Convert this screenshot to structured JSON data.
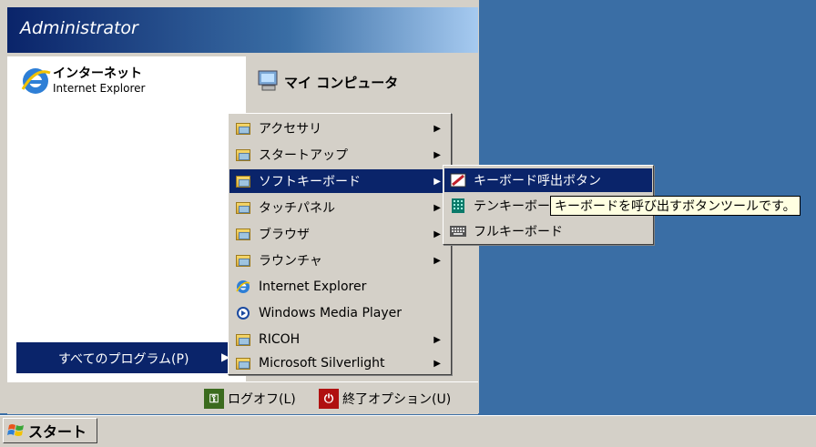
{
  "start_menu": {
    "user_name": "Administrator",
    "pinned_ie_title": "インターネット",
    "pinned_ie_subtitle": "Internet Explorer",
    "my_computer": "マイ コンピュータ",
    "all_programs": "すべてのプログラム(P)",
    "logoff": "ログオフ(L)",
    "shutdown": "終了オプション(U)"
  },
  "programs_menu": {
    "items": [
      {
        "label": "アクセサリ",
        "icon": "folder-icon",
        "has_submenu": true
      },
      {
        "label": "スタートアップ",
        "icon": "folder-icon",
        "has_submenu": true
      },
      {
        "label": "ソフトキーボード",
        "icon": "folder-icon",
        "has_submenu": true,
        "selected": true
      },
      {
        "label": "タッチパネル",
        "icon": "folder-icon",
        "has_submenu": true
      },
      {
        "label": "ブラウザ",
        "icon": "folder-icon",
        "has_submenu": true
      },
      {
        "label": "ラウンチャ",
        "icon": "folder-icon",
        "has_submenu": true
      },
      {
        "label": "Internet Explorer",
        "icon": "ie-icon",
        "has_submenu": false
      },
      {
        "label": "Windows Media Player",
        "icon": "media-player-icon",
        "has_submenu": false
      },
      {
        "label": "RICOH",
        "icon": "folder-icon",
        "has_submenu": true
      },
      {
        "label": "Microsoft Silverlight",
        "icon": "folder-icon",
        "has_submenu": true
      }
    ]
  },
  "softkeyboard_menu": {
    "items": [
      {
        "label": "キーボード呼出ボタン",
        "icon": "pen-keyboard-icon",
        "selected": true
      },
      {
        "label": "テンキーボード",
        "icon": "tenkey-icon"
      },
      {
        "label": "フルキーボード",
        "icon": "keyboard-icon"
      }
    ]
  },
  "tooltip": "キーボードを呼び出すボタンツールです。",
  "taskbar": {
    "start_label": "スタート"
  },
  "colors": {
    "desktop": "#3a6ea5",
    "selection": "#0a246a",
    "menu_bg": "#d4d0c8"
  }
}
